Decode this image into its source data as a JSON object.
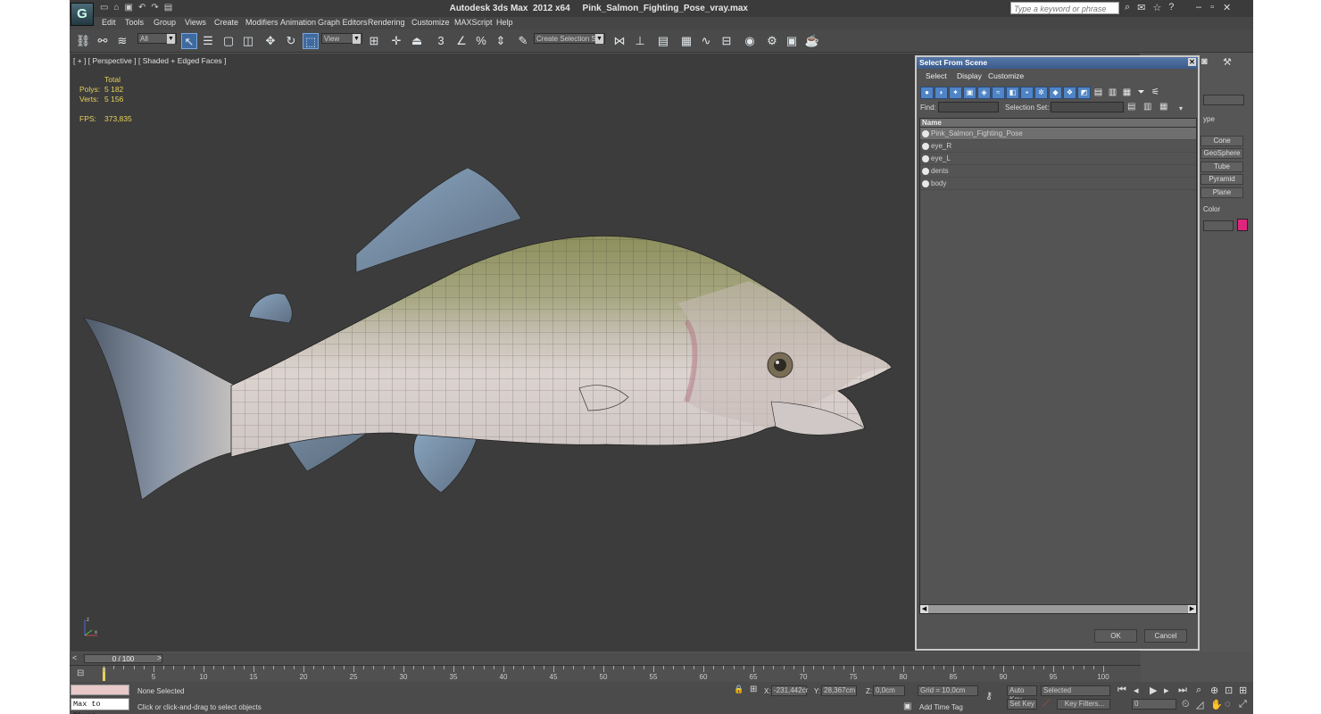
{
  "window": {
    "title": "Autodesk 3ds Max  2012 x64     Pink_Salmon_Fighting_Pose_vray.max",
    "search_placeholder": "Type a keyword or phrase"
  },
  "menu": [
    "Edit",
    "Tools",
    "Group",
    "Views",
    "Create",
    "Modifiers",
    "Animation",
    "Graph Editors",
    "Rendering",
    "Customize",
    "MAXScript",
    "Help"
  ],
  "toolbar": {
    "filter_value": "All",
    "coord_system": "View",
    "named_selection_placeholder": "Create Selection Se"
  },
  "viewport": {
    "label": "[ + ] [ Perspective ] [ Shaded + Edged Faces ]",
    "stats_header": "Total",
    "polys_label": "Polys:",
    "polys_value": "5 182",
    "verts_label": "Verts:",
    "verts_value": "5 156",
    "fps_label": "FPS:",
    "fps_value": "373,835"
  },
  "command_panel": {
    "type_label": "ype",
    "buttons": [
      "Cone",
      "GeoSphere",
      "Tube",
      "Pyramid",
      "Plane"
    ],
    "color_label": "Color",
    "accent": "#e0257f"
  },
  "dialog": {
    "title": "Select From Scene",
    "menu": [
      "Select",
      "Display",
      "Customize"
    ],
    "find_label": "Find:",
    "selection_set_label": "Selection Set:",
    "column_name": "Name",
    "items": [
      {
        "name": "Pink_Salmon_Fighting_Pose",
        "selected": true
      },
      {
        "name": "eye_R",
        "selected": false
      },
      {
        "name": "eye_L",
        "selected": false
      },
      {
        "name": "dents",
        "selected": false
      },
      {
        "name": "body",
        "selected": false
      }
    ],
    "ok_label": "OK",
    "cancel_label": "Cancel"
  },
  "timeline": {
    "frame_label": "0 / 100",
    "ticks": [
      "5",
      "10",
      "15",
      "20",
      "25",
      "30",
      "35",
      "40",
      "45",
      "50",
      "55",
      "60",
      "65",
      "70",
      "75",
      "80",
      "85",
      "90",
      "95",
      "100"
    ]
  },
  "status": {
    "selection": "None Selected",
    "prompt": "Click or click-and-drag to select objects",
    "maxscript": "Max to Physc.",
    "x_label": "X:",
    "x_value": "-231,442cr",
    "y_label": "Y:",
    "y_value": "28,367cm",
    "z_label": "Z:",
    "z_value": "0,0cm",
    "grid": "Grid = 10,0cm",
    "add_time_tag": "Add Time Tag",
    "auto_key": "Auto Key",
    "set_key": "Set Key",
    "key_mode": "Selected",
    "key_filters": "Key Filters...",
    "frame": "0"
  }
}
